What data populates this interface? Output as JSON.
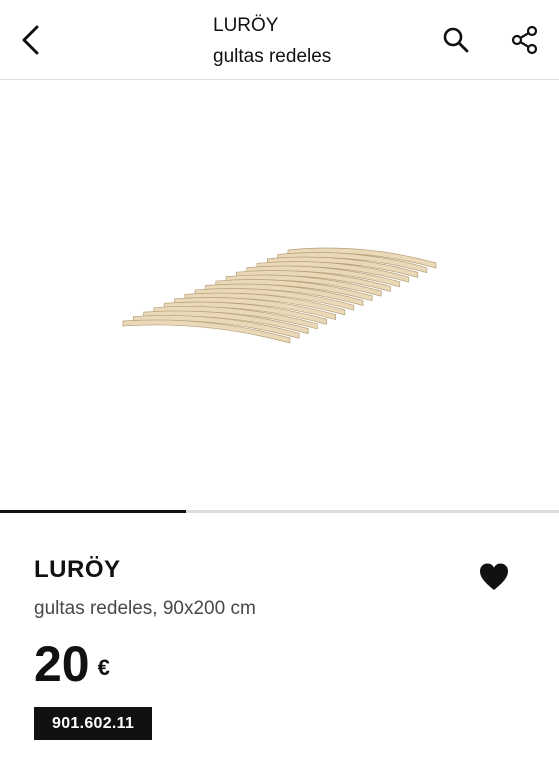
{
  "header": {
    "title": "LURÖY",
    "subtitle": "gultas redeles",
    "back_icon": "chevron-left-icon",
    "search_icon": "search-icon",
    "share_icon": "share-icon"
  },
  "gallery": {
    "image_alt": "LURÖY slatted bed base",
    "progress_fraction": 0.333
  },
  "product": {
    "name": "LURÖY",
    "description": "gultas redeles, 90x200 cm",
    "price_value": "20",
    "price_currency": "€",
    "article_number": "901.602.11",
    "favorite_icon": "heart-icon"
  },
  "colors": {
    "text": "#111111",
    "muted_text": "#484848",
    "divider": "#dfdfdf",
    "track": "#dcdcdc",
    "slat_wood": "#e9d9b8",
    "badge_bg": "#111111"
  }
}
